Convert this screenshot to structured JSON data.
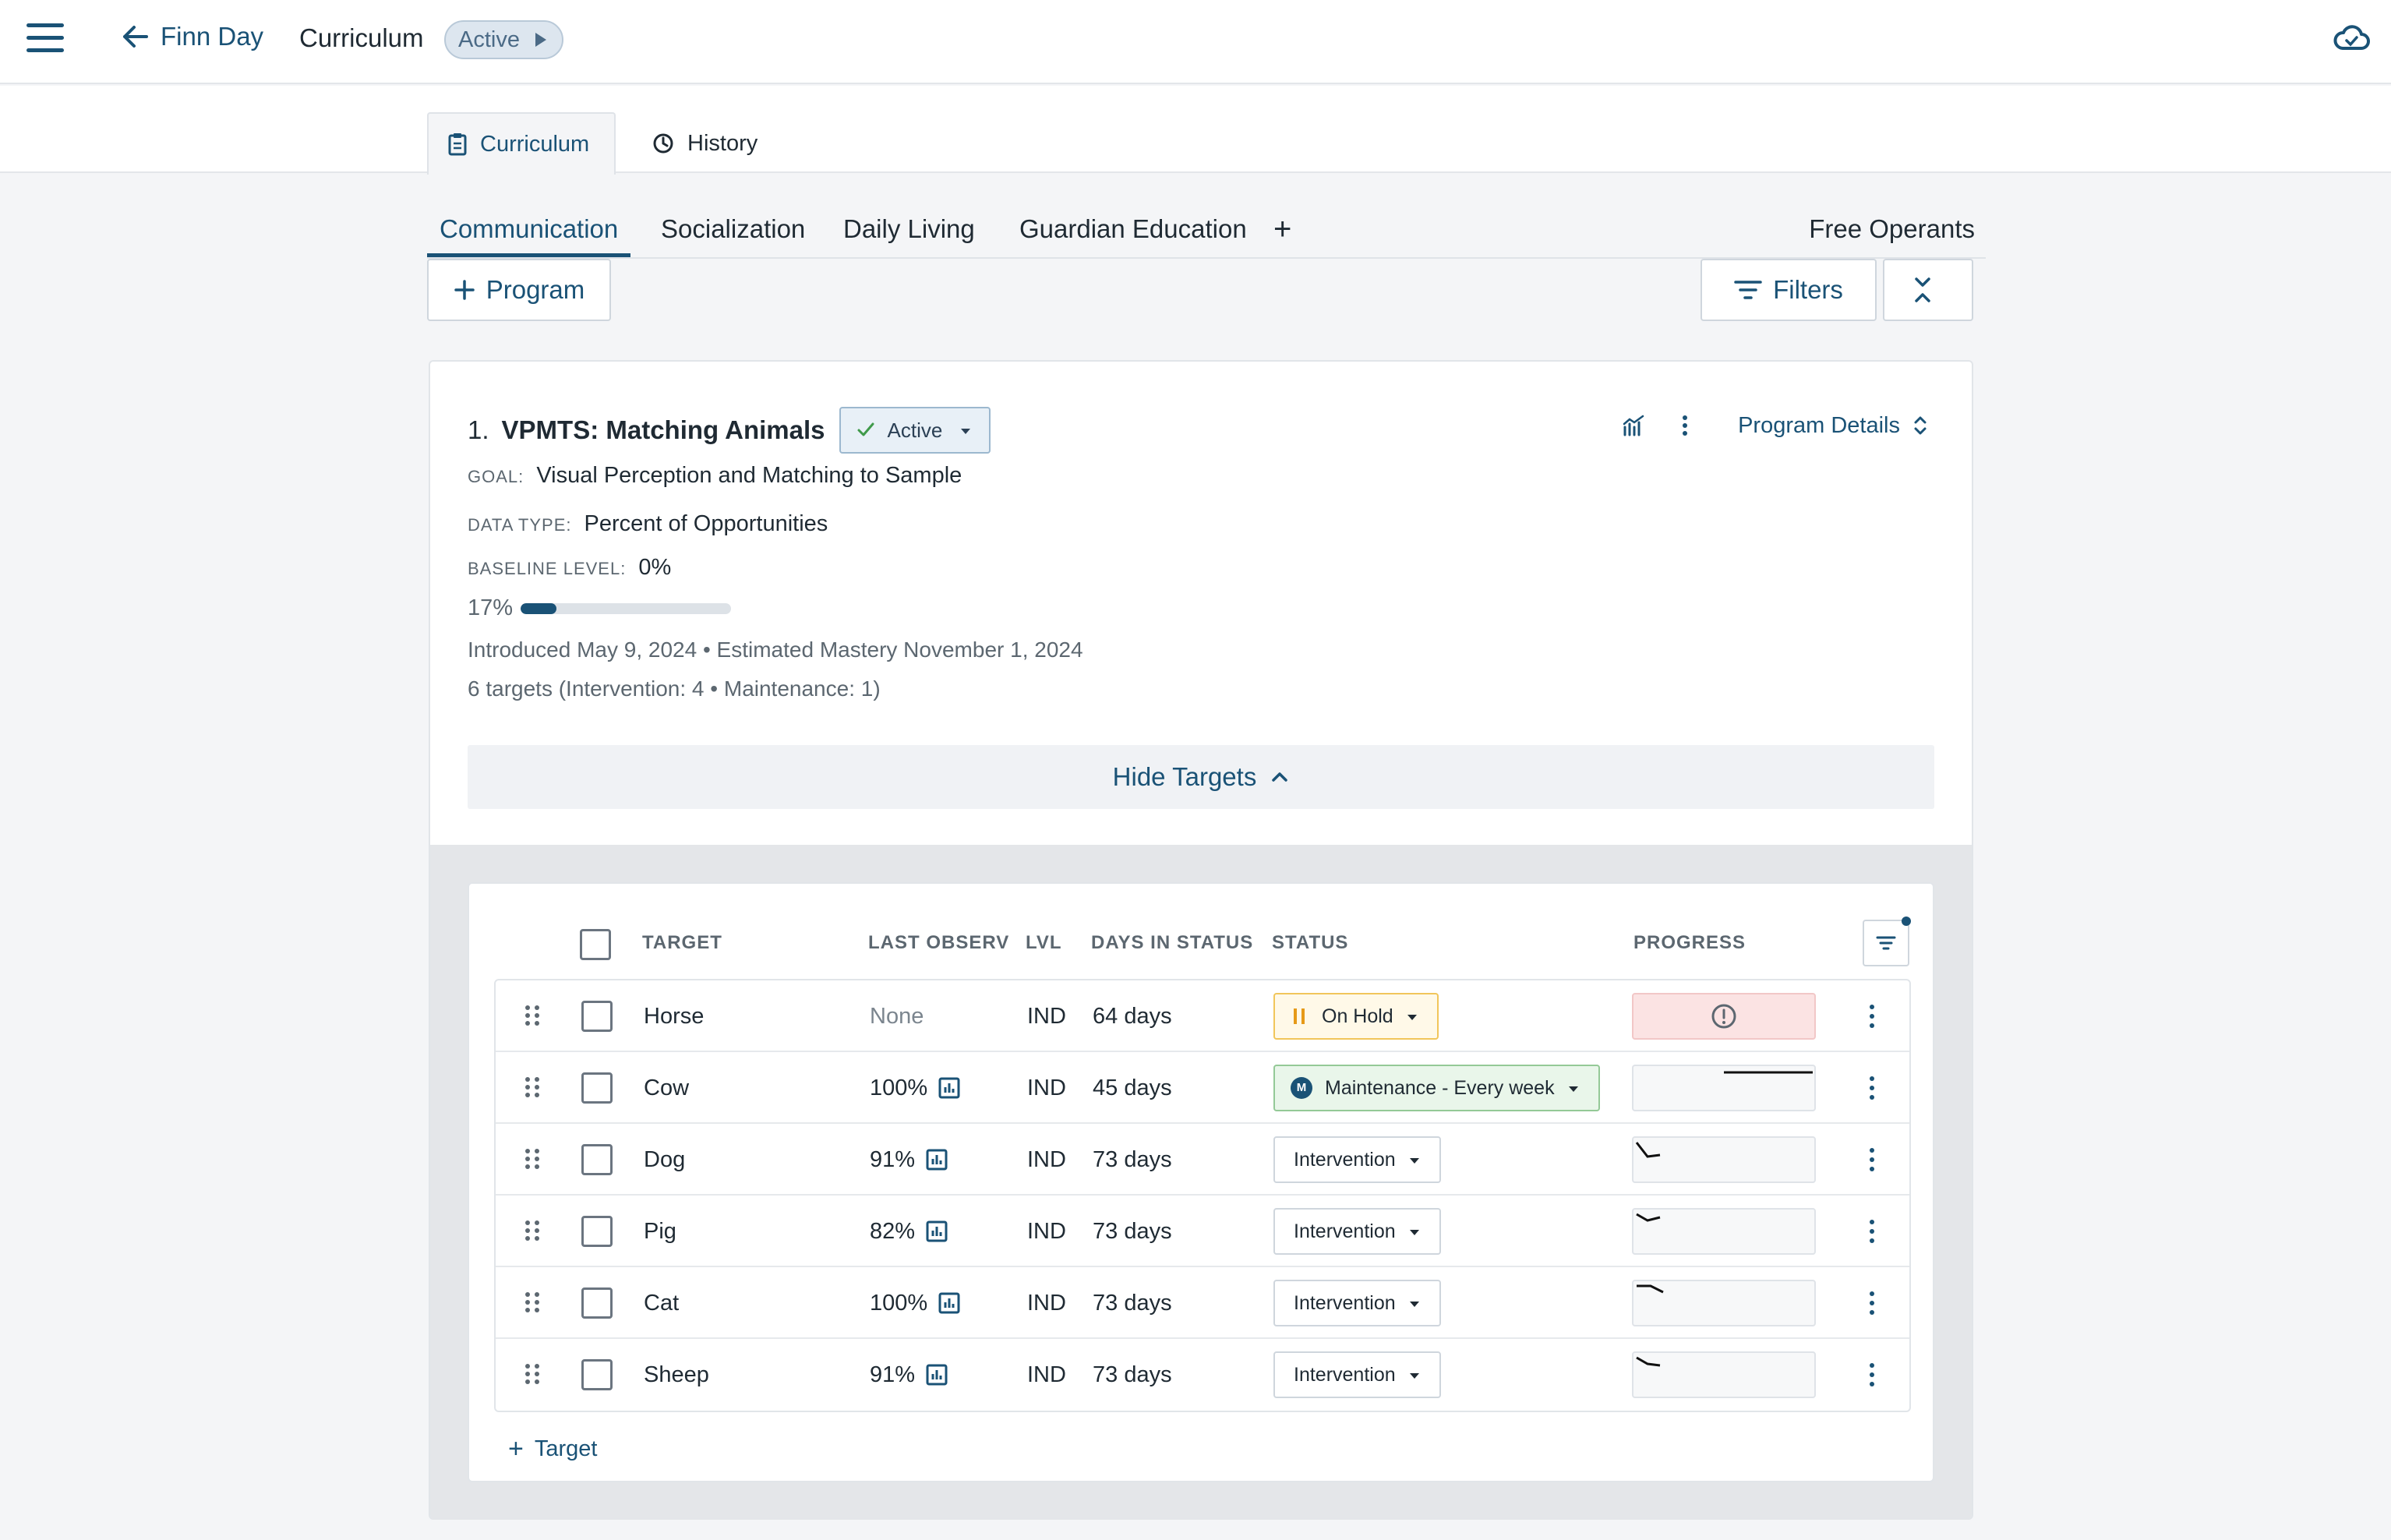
{
  "header": {
    "back_label": "Finn Day",
    "title": "Curriculum",
    "status_badge": "Active"
  },
  "page_tabs": [
    {
      "label": "Curriculum",
      "active": true
    },
    {
      "label": "History",
      "active": false
    }
  ],
  "category_tabs": {
    "items": [
      "Communication",
      "Socialization",
      "Daily Living",
      "Guardian Education"
    ],
    "active": "Communication",
    "add_label": "+",
    "free_operants_label": "Free Operants"
  },
  "toolbar": {
    "add_program_label": "Program",
    "filters_label": "Filters"
  },
  "program": {
    "number": "1.",
    "name": "VPMTS: Matching Animals",
    "status": "Active",
    "details_label": "Program Details",
    "goal_key": "GOAL:",
    "goal_value": "Visual Perception and Matching to Sample",
    "data_type_key": "DATA TYPE:",
    "data_type_value": "Percent of Opportunities",
    "baseline_key": "BASELINE LEVEL:",
    "baseline_value": "0%",
    "progress_label": "17%",
    "progress_fraction": 0.17,
    "dates_line": "Introduced May 9, 2024 • Estimated Mastery November 1, 2024",
    "targets_summary": "6 targets (Intervention: 4 • Maintenance: 1)",
    "hide_targets_label": "Hide Targets"
  },
  "targets_table": {
    "columns": {
      "target": "TARGET",
      "last_observ": "LAST OBSERV",
      "lvl": "LVL",
      "days_in_status": "DAYS IN STATUS",
      "status": "STATUS",
      "progress": "PROGRESS"
    },
    "rows": [
      {
        "target": "Horse",
        "last_observ": "None",
        "lvl": "IND",
        "days": "64 days",
        "status": "On Hold",
        "status_kind": "hold"
      },
      {
        "target": "Cow",
        "last_observ": "100%",
        "lvl": "IND",
        "days": "45 days",
        "status": "Maintenance - Every week",
        "status_kind": "maint",
        "maint_badge": "M"
      },
      {
        "target": "Dog",
        "last_observ": "91%",
        "lvl": "IND",
        "days": "73 days",
        "status": "Intervention",
        "status_kind": "int"
      },
      {
        "target": "Pig",
        "last_observ": "82%",
        "lvl": "IND",
        "days": "73 days",
        "status": "Intervention",
        "status_kind": "int"
      },
      {
        "target": "Cat",
        "last_observ": "100%",
        "lvl": "IND",
        "days": "73 days",
        "status": "Intervention",
        "status_kind": "int"
      },
      {
        "target": "Sheep",
        "last_observ": "91%",
        "lvl": "IND",
        "days": "73 days",
        "status": "Intervention",
        "status_kind": "int"
      }
    ],
    "add_target_label": "Target"
  },
  "colors": {
    "accent": "#1a5276",
    "hold": "#e69a18",
    "maintenance": "#94c997",
    "alert_bg": "#fbe3e3"
  },
  "icons": [
    "hamburger-icon",
    "arrow-left-icon",
    "cloud-sync-icon",
    "clipboard-icon",
    "clock-icon",
    "plus-icon",
    "filter-icon",
    "collapse-icon",
    "chart-icon",
    "kebab-icon",
    "chevron-updown-icon",
    "chevron-up-icon",
    "drag-handle-icon",
    "bar-chart-icon",
    "alert-circle-icon"
  ]
}
